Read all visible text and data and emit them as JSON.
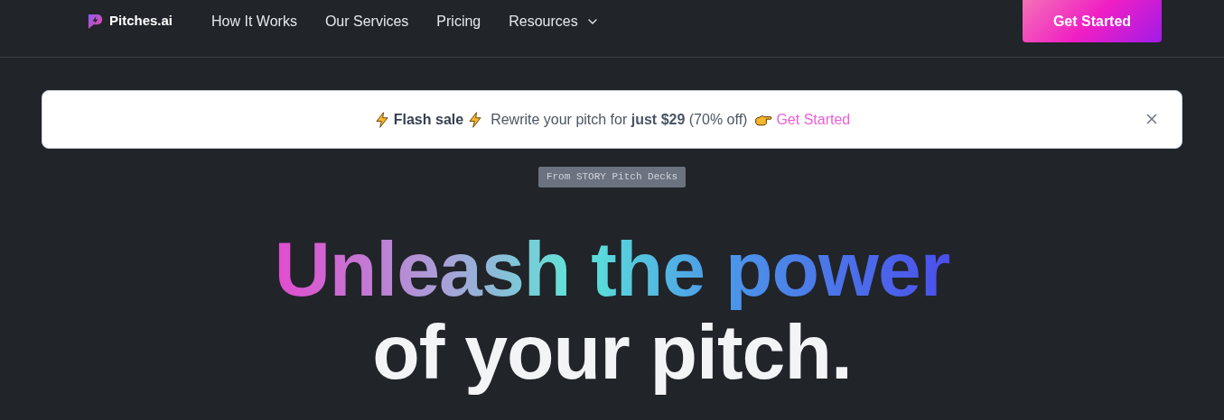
{
  "nav": {
    "brand": "Pitches.ai",
    "links": [
      {
        "label": "How It Works",
        "dropdown": false
      },
      {
        "label": "Our Services",
        "dropdown": false
      },
      {
        "label": "Pricing",
        "dropdown": false
      },
      {
        "label": "Resources",
        "dropdown": true
      }
    ],
    "cta": "Get Started"
  },
  "banner": {
    "title": "Flash sale",
    "message": "Rewrite your pitch for **just $29** (70% off)",
    "link": "Get Started"
  },
  "tag": "From STORY Pitch Decks",
  "headline": {
    "gradient_line": "Unleash the power",
    "plain_line": "of your pitch."
  }
}
